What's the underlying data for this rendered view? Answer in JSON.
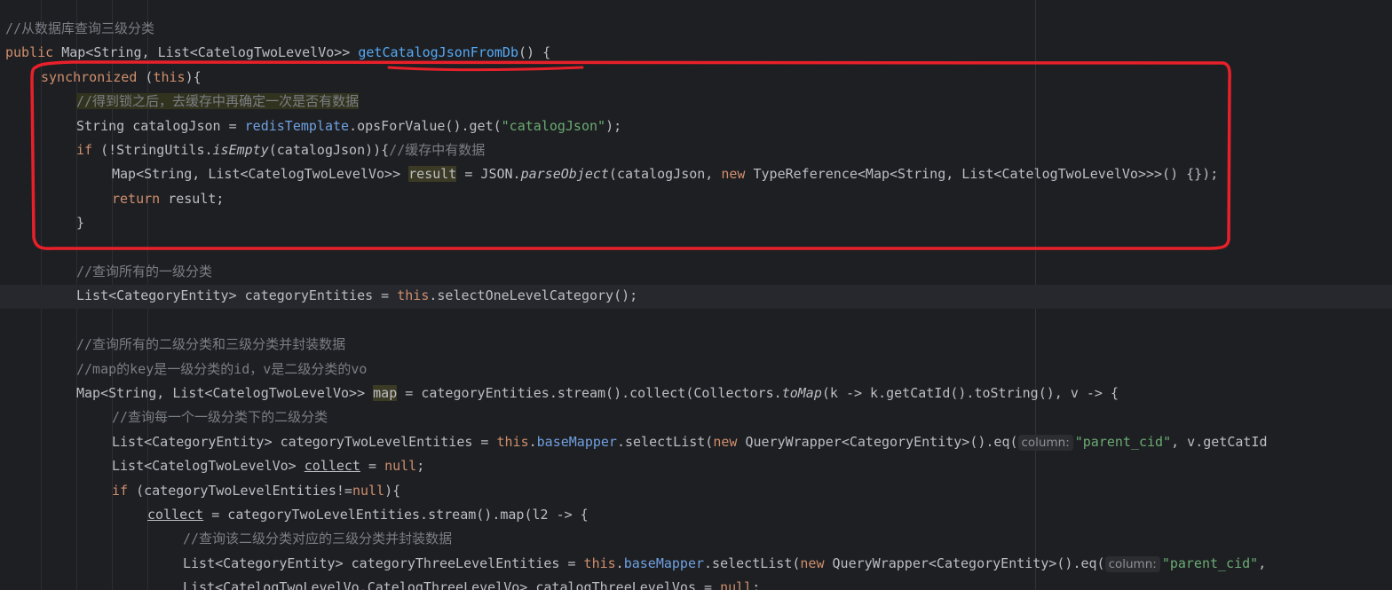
{
  "editor": {
    "lines": [
      {
        "indent": 0,
        "tokens": [
          {
            "t": "//从数据库查询三级分类",
            "c": "cmt"
          }
        ]
      },
      {
        "indent": 0,
        "tokens": [
          {
            "t": "public ",
            "c": "kw"
          },
          {
            "t": "Map<String, List<CatelogTwoLevelVo>> "
          },
          {
            "t": "getCatalogJsonFromDb",
            "c": "fn"
          },
          {
            "t": "() {"
          }
        ]
      },
      {
        "indent": 1,
        "tokens": [
          {
            "t": "synchronized ",
            "c": "kw"
          },
          {
            "t": "("
          },
          {
            "t": "this",
            "c": "kw"
          },
          {
            "t": "){"
          }
        ]
      },
      {
        "indent": 2,
        "tokens": [
          {
            "t": "//得到锁之后，去缓存中再确定一次是否有数据",
            "c": "cmt-hl"
          }
        ]
      },
      {
        "indent": 2,
        "tokens": [
          {
            "t": "String catalogJson = "
          },
          {
            "t": "redisTemplate",
            "c": "fld"
          },
          {
            "t": ".opsForValue().get("
          },
          {
            "t": "\"catalogJson\"",
            "c": "str"
          },
          {
            "t": ");"
          }
        ]
      },
      {
        "indent": 2,
        "tokens": [
          {
            "t": "if ",
            "c": "kw"
          },
          {
            "t": "(!StringUtils."
          },
          {
            "t": "isEmpty",
            "c": "ital"
          },
          {
            "t": "(catalogJson)){"
          },
          {
            "t": "//缓存中有数据",
            "c": "cmt"
          }
        ]
      },
      {
        "indent": 3,
        "tokens": [
          {
            "t": "Map<String, List<CatelogTwoLevelVo>> "
          },
          {
            "t": "result",
            "c": "hl-var"
          },
          {
            "t": " = JSON."
          },
          {
            "t": "parseObject",
            "c": "ital"
          },
          {
            "t": "(catalogJson, "
          },
          {
            "t": "new ",
            "c": "kw"
          },
          {
            "t": "TypeReference<Map<String, List<CatelogTwoLevelVo>>>() {});"
          }
        ]
      },
      {
        "indent": 3,
        "tokens": [
          {
            "t": "return ",
            "c": "kw"
          },
          {
            "t": "result;"
          }
        ]
      },
      {
        "indent": 2,
        "tokens": [
          {
            "t": "}"
          }
        ]
      },
      {
        "indent": 0,
        "tokens": []
      },
      {
        "indent": 2,
        "tokens": [
          {
            "t": "//查询所有的一级分类",
            "c": "cmt"
          }
        ]
      },
      {
        "indent": 2,
        "tokens": [
          {
            "t": "List<CategoryEntity> categoryEntities = "
          },
          {
            "t": "this",
            "c": "kw"
          },
          {
            "t": ".selectOneLevelCategory();"
          }
        ]
      },
      {
        "indent": 0,
        "tokens": []
      },
      {
        "indent": 2,
        "tokens": [
          {
            "t": "//查询所有的二级分类和三级分类并封装数据",
            "c": "cmt"
          }
        ]
      },
      {
        "indent": 2,
        "tokens": [
          {
            "t": "//map的key是一级分类的id，v是二级分类的vo",
            "c": "cmt"
          }
        ]
      },
      {
        "indent": 2,
        "tokens": [
          {
            "t": "Map<String, List<CatelogTwoLevelVo>> "
          },
          {
            "t": "map",
            "c": "hl-var"
          },
          {
            "t": " = categoryEntities.stream().collect(Collectors."
          },
          {
            "t": "toMap",
            "c": "ital"
          },
          {
            "t": "(k -> k.getCatId().toString(), v -> {"
          }
        ]
      },
      {
        "indent": 3,
        "tokens": [
          {
            "t": "//查询每一个一级分类下的二级分类",
            "c": "cmt"
          }
        ]
      },
      {
        "indent": 3,
        "tokens": [
          {
            "t": "List<CategoryEntity> categoryTwoLevelEntities = "
          },
          {
            "t": "this",
            "c": "kw"
          },
          {
            "t": "."
          },
          {
            "t": "baseMapper",
            "c": "fld"
          },
          {
            "t": ".selectList("
          },
          {
            "t": "new ",
            "c": "kw"
          },
          {
            "t": "QueryWrapper<CategoryEntity>().eq("
          },
          {
            "t": "column:",
            "c": "hint"
          },
          {
            "t": "\"parent_cid\"",
            "c": "str"
          },
          {
            "t": ", v.getCatId"
          }
        ]
      },
      {
        "indent": 3,
        "tokens": [
          {
            "t": "List<CatelogTwoLevelVo> "
          },
          {
            "t": "collect",
            "c": "ul"
          },
          {
            "t": " = "
          },
          {
            "t": "null",
            "c": "kw"
          },
          {
            "t": ";"
          }
        ]
      },
      {
        "indent": 3,
        "tokens": [
          {
            "t": "if ",
            "c": "kw"
          },
          {
            "t": "(categoryTwoLevelEntities!="
          },
          {
            "t": "null",
            "c": "kw"
          },
          {
            "t": "){"
          }
        ]
      },
      {
        "indent": 4,
        "tokens": [
          {
            "t": "collect",
            "c": "ul"
          },
          {
            "t": " = categoryTwoLevelEntities.stream().map(l2 -> {"
          }
        ]
      },
      {
        "indent": 5,
        "tokens": [
          {
            "t": "//查询该二级分类对应的三级分类并封装数据",
            "c": "cmt"
          }
        ]
      },
      {
        "indent": 5,
        "tokens": [
          {
            "t": "List<CategoryEntity> categoryThreeLevelEntities = "
          },
          {
            "t": "this",
            "c": "kw"
          },
          {
            "t": "."
          },
          {
            "t": "baseMapper",
            "c": "fld"
          },
          {
            "t": ".selectList("
          },
          {
            "t": "new ",
            "c": "kw"
          },
          {
            "t": "QueryWrapper<CategoryEntity>().eq("
          },
          {
            "t": "column:",
            "c": "hint"
          },
          {
            "t": "\"parent_cid\"",
            "c": "str"
          },
          {
            "t": ","
          }
        ]
      },
      {
        "indent": 5,
        "tokens": [
          {
            "t": "List<CatelogTwoLevelVo.CatelogThreeLevelVo> catalogThreeLevelVos = "
          },
          {
            "t": "null",
            "c": "kw"
          },
          {
            "t": ";"
          }
        ]
      }
    ]
  },
  "annotation": {
    "color": "#e8202a",
    "note": ""
  }
}
